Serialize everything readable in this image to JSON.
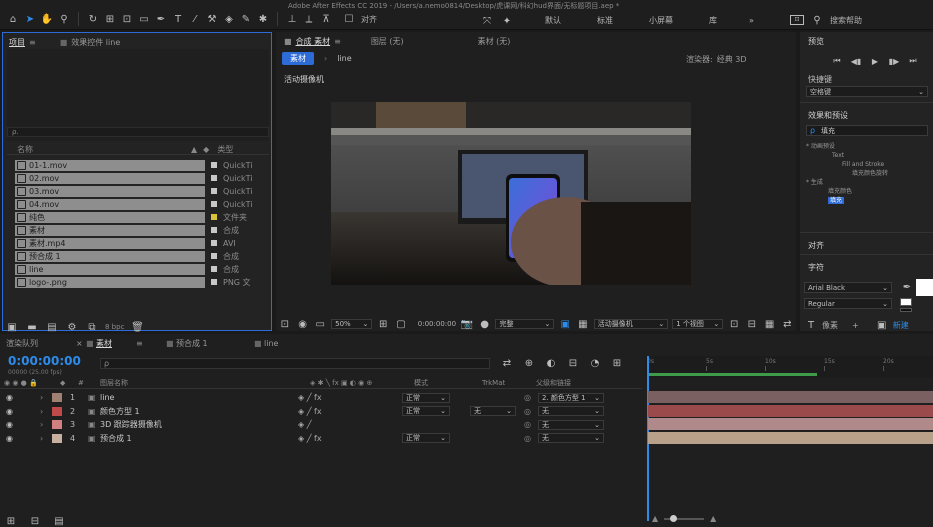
{
  "app": {
    "title": "Adobe After Effects CC 2019 - /Users/a.nemo0814/Desktop/虎课网/科幻hud界面/无标题项目.aep *"
  },
  "toolbar": {
    "align_label": "对齐",
    "workspaces": [
      "默认",
      "标准",
      "小屏幕",
      "库"
    ],
    "search_label": "搜索帮助"
  },
  "project_panel": {
    "tabs": [
      "项目",
      "效果控件 line"
    ],
    "search_placeholder": "ρ.",
    "col_name": "名称",
    "col_type": "类型",
    "items": [
      {
        "name": "01-1.mov",
        "type": "QuickTi",
        "color": "#c8c8c8"
      },
      {
        "name": "02.mov",
        "type": "QuickTi",
        "color": "#c8c8c8"
      },
      {
        "name": "03.mov",
        "type": "QuickTi",
        "color": "#c8c8c8"
      },
      {
        "name": "04.mov",
        "type": "QuickTi",
        "color": "#c8c8c8"
      },
      {
        "name": "纯色",
        "type": "文件夹",
        "color": "#d8c23a"
      },
      {
        "name": "素材",
        "type": "合成",
        "color": "#c8c8c8"
      },
      {
        "name": "素材.mp4",
        "type": "AVI",
        "color": "#c8c8c8"
      },
      {
        "name": "预合成 1",
        "type": "合成",
        "color": "#c8c8c8"
      },
      {
        "name": "line",
        "type": "合成",
        "color": "#c8c8c8"
      },
      {
        "name": "logo-.png",
        "type": "PNG 文",
        "color": "#c8c8c8"
      }
    ],
    "bpc_label": "8 bpc"
  },
  "composition_panel": {
    "tab_comp": "合成 素材",
    "tab_layer": "图层 (无)",
    "tab_footage": "素材 (无)",
    "sub_tabs": [
      "素材",
      "line"
    ],
    "renderer_label": "渲染器:",
    "renderer_value": "经典 3D",
    "camera_label": "活动摄像机",
    "zoom": "50%",
    "timecode": "0:00:00:00",
    "quality": "完整",
    "view_camera": "活动摄像机",
    "view_count": "1 个视图"
  },
  "right_panel": {
    "preview_title": "预览",
    "shortcut_label": "快捷键",
    "shortcut_value": "空格键",
    "effects_title": "效果和预设",
    "effects_search": "填充",
    "tree": [
      "* 动画预设",
      "Text",
      "Fill and Stroke",
      "填充颜色旋转",
      "* 生成",
      "填充颜色",
      "填充"
    ],
    "align_title": "对齐",
    "char_title": "字符",
    "font": "Arial Black",
    "style": "Regular",
    "size_unit": "像素",
    "new_label": "新建"
  },
  "timeline": {
    "tabs": [
      "渲染队列",
      "素材",
      "预合成 1",
      "line"
    ],
    "timecode": "0:00:00:00",
    "frame_info": "00000 (25.00 fps)",
    "col_layer_name": "图层名称",
    "col_mode": "模式",
    "col_trkmat": "TrkMat",
    "col_parent": "父级和链接",
    "layers": [
      {
        "num": "1",
        "name": "line",
        "color": "#a08070",
        "mode": "正常",
        "trkmat": "",
        "parent": "2. 颜色方型 1",
        "bar": "#7a6060"
      },
      {
        "num": "2",
        "name": "颜色方型 1",
        "color": "#c04a4a",
        "mode": "正常",
        "trkmat": "无",
        "parent": "无",
        "bar": "#9a4a4a"
      },
      {
        "num": "3",
        "name": "3D 跟踪器摄像机",
        "color": "#d08080",
        "mode": "",
        "trkmat": "",
        "parent": "无",
        "bar": "#b08a8a"
      },
      {
        "num": "4",
        "name": "预合成 1",
        "color": "#c8b0a0",
        "mode": "正常",
        "trkmat": "",
        "parent": "无",
        "bar": "#b8a08a"
      }
    ],
    "ruler_labels": [
      "0s",
      "5s",
      "10s",
      "15s",
      "20s"
    ]
  },
  "colors": {
    "accent": "#2d8ceb",
    "panel_bg": "#232323",
    "highlight_border": "#2d6cd6"
  }
}
